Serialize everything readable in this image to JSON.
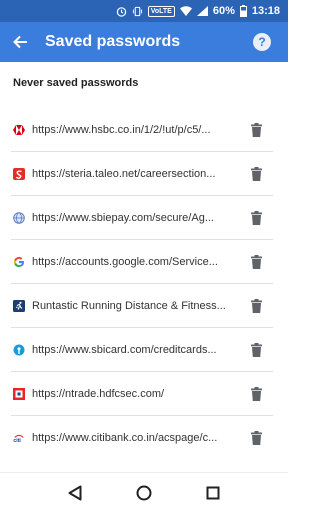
{
  "status_bar": {
    "battery": "60%",
    "time": "13:18",
    "network_badge": "VoLTE"
  },
  "app_bar": {
    "title": "Saved passwords",
    "help_label": "?"
  },
  "section": {
    "title": "Never saved passwords"
  },
  "entries": [
    {
      "url": "https://www.hsbc.co.in/1/2/!ut/p/c5/...",
      "icon": "hsbc-favicon"
    },
    {
      "url": "https://steria.taleo.net/careersection...",
      "icon": "steria-favicon"
    },
    {
      "url": "https://www.sbiepay.com/secure/Ag...",
      "icon": "sbiepay-favicon"
    },
    {
      "url": "https://accounts.google.com/Service...",
      "icon": "google-favicon"
    },
    {
      "url": "Runtastic Running Distance & Fitness...",
      "icon": "runtastic-favicon"
    },
    {
      "url": "https://www.sbicard.com/creditcards...",
      "icon": "sbicard-favicon"
    },
    {
      "url": "https://ntrade.hdfcsec.com/",
      "icon": "hdfcsec-favicon"
    },
    {
      "url": "https://www.citibank.co.in/acspage/c...",
      "icon": "citi-favicon"
    }
  ],
  "colors": {
    "app_bar": "#3b7ddd",
    "status_bar": "#2b63b5",
    "icon_gray": "#5f6368"
  }
}
